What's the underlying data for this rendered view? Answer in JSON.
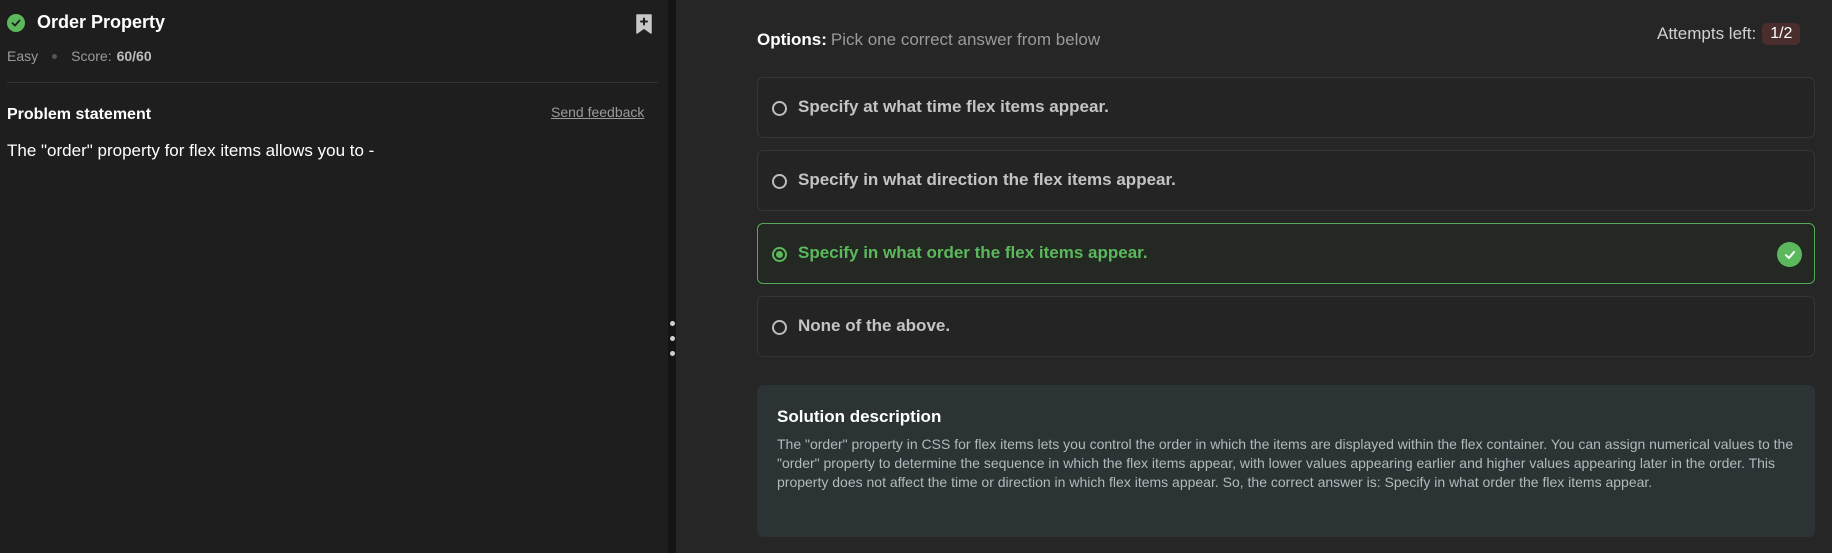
{
  "problem": {
    "title": "Order Property",
    "difficulty": "Easy",
    "score_label": "Score:",
    "score_value": "60/60",
    "statement_label": "Problem statement",
    "feedback_link": "Send feedback",
    "statement": "The \"order\" property for flex items allows you to -"
  },
  "options": {
    "label": "Options:",
    "hint": "Pick one correct answer from below",
    "attempts_label": "Attempts left:",
    "attempts_value": "1/2",
    "items": [
      {
        "text": "Specify at what time flex items appear.",
        "selected": false
      },
      {
        "text": "Specify in what direction the flex items appear.",
        "selected": false
      },
      {
        "text": "Specify in what order the flex items appear.",
        "selected": true
      },
      {
        "text": "None of the above.",
        "selected": false
      }
    ]
  },
  "solution": {
    "title": "Solution description",
    "text": "The \"order\" property in CSS for flex items lets you control the order in which the items are displayed within the flex container. You can assign numerical values to the \"order\" property to determine the sequence in which the flex items appear, with lower values appearing earlier and higher values appearing later in the order. This property does not affect the time or direction in which flex items appear. So, the correct answer is: Specify in what order the flex items appear."
  },
  "colors": {
    "accent_green": "#5cb85c",
    "attempts_badge": "#4a2e2e",
    "solution_bg": "#2b3335"
  },
  "icons": {
    "status": "check-circle-icon",
    "bookmark": "bookmark-plus-icon",
    "correct": "check-circle-icon",
    "splitter": "vertical-dots-icon"
  }
}
